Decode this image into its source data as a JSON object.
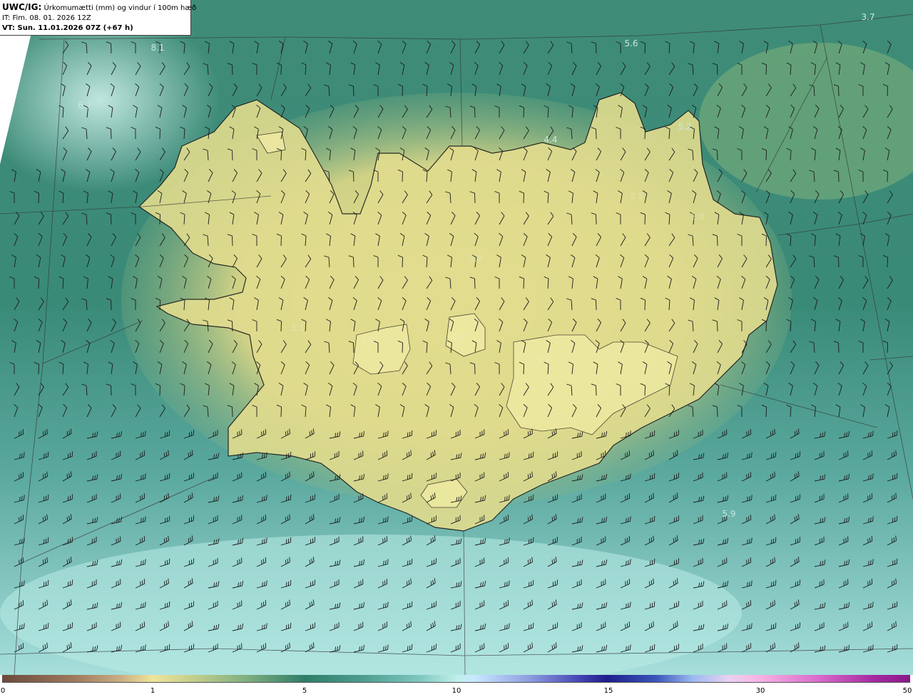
{
  "header": {
    "model_code": "UWC/IG:",
    "title_text": " Úrkomumætti (mm) og vindur í 100m hæð",
    "init_time": "IT: Fim. 08. 01. 2026 12Z",
    "valid_time": "VT: Sun. 11.01.2026 07Z (+67 h)"
  },
  "value_labels": [
    {
      "text": "3.7"
    },
    {
      "text": "5.6"
    },
    {
      "text": "8.1"
    },
    {
      "text": "6.7"
    },
    {
      "text": "5.2"
    },
    {
      "text": "4.4"
    },
    {
      "text": "2.8"
    },
    {
      "text": "2.0"
    },
    {
      "text": "0.8"
    },
    {
      "text": "1.1"
    },
    {
      "text": "1.0"
    },
    {
      "text": "0.7"
    },
    {
      "text": "0.9"
    },
    {
      "text": "5.9"
    }
  ],
  "colorbar": {
    "ticks": [
      "0",
      "1",
      "5",
      "10",
      "15",
      "30",
      "50"
    ],
    "colors": [
      "#6b4a3c",
      "#eee59a",
      "#2f7d68",
      "#bfeeea",
      "#1e1e8c",
      "#f6b4e4",
      "#8a1a8a"
    ]
  },
  "colors": {
    "ocean_teal": "#3e8f7c",
    "land_yellow": "#e2dd8f",
    "coast_line": "#1a1a1a",
    "barb_line": "#1a1a1a"
  }
}
